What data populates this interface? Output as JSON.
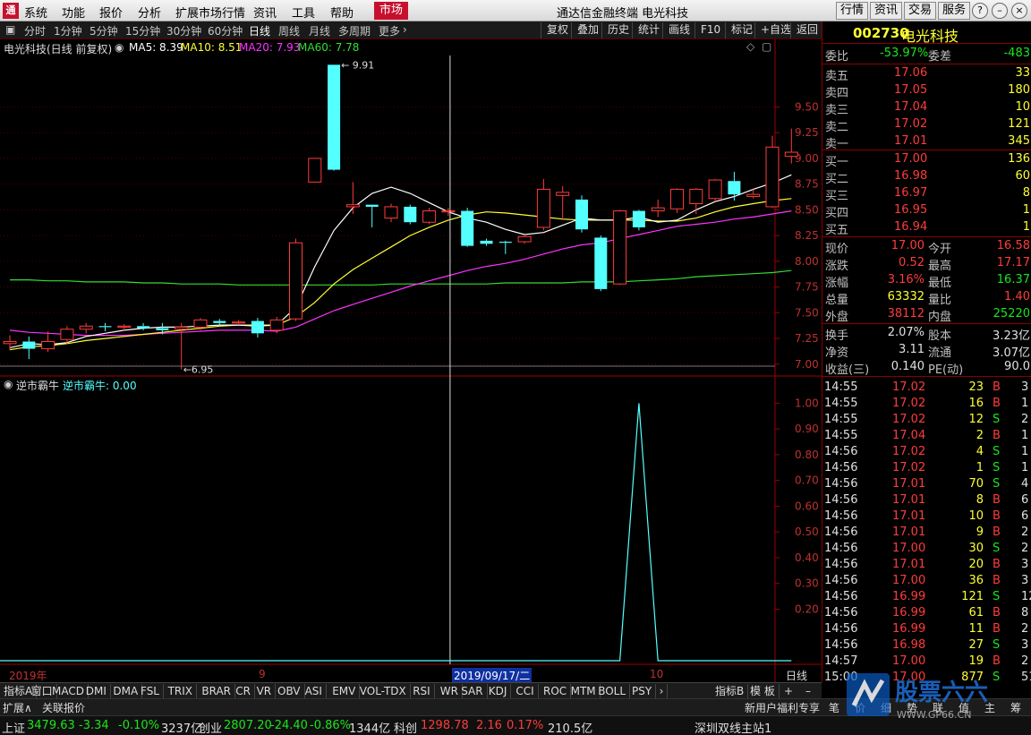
{
  "titlebar": {
    "logo": "通",
    "menu": [
      "系统",
      "功能",
      "报价",
      "分析",
      "扩展市场行情",
      "资讯",
      "工具",
      "帮助"
    ],
    "market_tab": "市场",
    "app_title": "通达信金融终端  电光科技",
    "buttons": [
      "行情",
      "资讯",
      "交易",
      "服务"
    ],
    "window_buttons": [
      "?",
      "–",
      "□",
      "×"
    ]
  },
  "periods": {
    "items": [
      "分时",
      "1分钟",
      "5分钟",
      "15分钟",
      "30分钟",
      "60分钟",
      "日线",
      "周线",
      "月线",
      "多周期",
      "更多"
    ],
    "active": "日线",
    "tools": [
      "复权",
      "叠加",
      "历史",
      "统计",
      "画线",
      "F10",
      "标记",
      "+自选",
      "返回"
    ]
  },
  "main_chart": {
    "title": "电光科技(日线 前复权)",
    "ma_labels": [
      {
        "text": "MA5: 8.39",
        "color": "#ffffff"
      },
      {
        "text": "MA10: 8.51",
        "color": "#ffff33"
      },
      {
        "text": "MA20: 7.93",
        "color": "#ff33ff"
      },
      {
        "text": "MA60: 7.78",
        "color": "#33dd33"
      }
    ],
    "high_label": "9.91",
    "low_label": "6.95",
    "y_ticks": [
      "9.50",
      "9.25",
      "9.00",
      "8.75",
      "8.50",
      "8.25",
      "8.00",
      "7.75",
      "7.50",
      "7.25",
      "7.00"
    ]
  },
  "chart_data": [
    {
      "type": "candlestick",
      "title": "电光科技(日线 前复权)",
      "ylim": [
        6.92,
        10.0
      ],
      "candles": [
        {
          "o": 7.2,
          "h": 7.28,
          "l": 7.14,
          "c": 7.22
        },
        {
          "o": 7.22,
          "h": 7.27,
          "l": 7.05,
          "c": 7.15
        },
        {
          "o": 7.15,
          "h": 7.32,
          "l": 7.12,
          "c": 7.22
        },
        {
          "o": 7.24,
          "h": 7.37,
          "l": 7.2,
          "c": 7.34
        },
        {
          "o": 7.34,
          "h": 7.4,
          "l": 7.3,
          "c": 7.37
        },
        {
          "o": 7.37,
          "h": 7.4,
          "l": 7.32,
          "c": 7.36
        },
        {
          "o": 7.36,
          "h": 7.39,
          "l": 7.32,
          "c": 7.37
        },
        {
          "o": 7.37,
          "h": 7.4,
          "l": 7.33,
          "c": 7.35
        },
        {
          "o": 7.35,
          "h": 7.4,
          "l": 7.29,
          "c": 7.33
        },
        {
          "o": 7.34,
          "h": 7.4,
          "l": 6.95,
          "c": 7.36
        },
        {
          "o": 7.36,
          "h": 7.45,
          "l": 7.33,
          "c": 7.43
        },
        {
          "o": 7.42,
          "h": 7.44,
          "l": 7.38,
          "c": 7.4
        },
        {
          "o": 7.4,
          "h": 7.43,
          "l": 7.38,
          "c": 7.41
        },
        {
          "o": 7.42,
          "h": 7.45,
          "l": 7.26,
          "c": 7.3
        },
        {
          "o": 7.33,
          "h": 7.46,
          "l": 7.3,
          "c": 7.43
        },
        {
          "o": 7.44,
          "h": 8.22,
          "l": 7.42,
          "c": 8.18
        },
        {
          "o": 8.77,
          "h": 9.0,
          "l": 8.77,
          "c": 9.0
        },
        {
          "o": 9.91,
          "h": 9.91,
          "l": 8.88,
          "c": 8.89
        },
        {
          "o": 8.53,
          "h": 8.77,
          "l": 8.46,
          "c": 8.55
        },
        {
          "o": 8.55,
          "h": 8.55,
          "l": 8.33,
          "c": 8.53
        },
        {
          "o": 8.42,
          "h": 8.56,
          "l": 8.38,
          "c": 8.53
        },
        {
          "o": 8.53,
          "h": 8.55,
          "l": 8.36,
          "c": 8.38
        },
        {
          "o": 8.38,
          "h": 8.52,
          "l": 8.36,
          "c": 8.49
        },
        {
          "o": 8.48,
          "h": 8.52,
          "l": 8.44,
          "c": 8.49
        },
        {
          "o": 8.49,
          "h": 8.52,
          "l": 8.14,
          "c": 8.15
        },
        {
          "o": 8.2,
          "h": 8.22,
          "l": 8.15,
          "c": 8.17
        },
        {
          "o": 8.19,
          "h": 8.2,
          "l": 8.07,
          "c": 8.18
        },
        {
          "o": 8.19,
          "h": 8.26,
          "l": 8.17,
          "c": 8.24
        },
        {
          "o": 8.33,
          "h": 8.8,
          "l": 8.3,
          "c": 8.7
        },
        {
          "o": 8.64,
          "h": 8.73,
          "l": 8.4,
          "c": 8.67
        },
        {
          "o": 8.6,
          "h": 8.64,
          "l": 8.28,
          "c": 8.31
        },
        {
          "o": 8.23,
          "h": 8.25,
          "l": 7.71,
          "c": 7.73
        },
        {
          "o": 7.78,
          "h": 8.5,
          "l": 7.77,
          "c": 8.49
        },
        {
          "o": 8.49,
          "h": 8.5,
          "l": 8.3,
          "c": 8.33
        },
        {
          "o": 8.49,
          "h": 8.6,
          "l": 8.43,
          "c": 8.52
        },
        {
          "o": 8.51,
          "h": 8.71,
          "l": 8.47,
          "c": 8.7
        },
        {
          "o": 8.56,
          "h": 8.71,
          "l": 8.46,
          "c": 8.7
        },
        {
          "o": 8.61,
          "h": 8.8,
          "l": 8.58,
          "c": 8.79
        },
        {
          "o": 8.78,
          "h": 8.87,
          "l": 8.59,
          "c": 8.65
        },
        {
          "o": 8.63,
          "h": 8.7,
          "l": 8.61,
          "c": 8.65
        },
        {
          "o": 8.53,
          "h": 9.22,
          "l": 8.52,
          "c": 9.11
        },
        {
          "o": 9.02,
          "h": 9.29,
          "l": 8.95,
          "c": 9.06
        }
      ],
      "ma5": [
        7.16,
        7.2,
        7.19,
        7.21,
        7.27,
        7.3,
        7.33,
        7.35,
        7.36,
        7.36,
        7.37,
        7.38,
        7.38,
        7.37,
        7.38,
        7.55,
        7.95,
        8.3,
        8.52,
        8.66,
        8.72,
        8.66,
        8.57,
        8.48,
        8.42,
        8.38,
        8.31,
        8.26,
        8.28,
        8.35,
        8.42,
        8.4,
        8.4,
        8.43,
        8.38,
        8.4,
        8.5,
        8.58,
        8.63,
        8.7,
        8.76,
        8.84
      ],
      "ma10": [
        7.14,
        7.17,
        7.18,
        7.2,
        7.23,
        7.25,
        7.27,
        7.29,
        7.31,
        7.33,
        7.35,
        7.37,
        7.38,
        7.38,
        7.38,
        7.46,
        7.6,
        7.78,
        7.92,
        8.03,
        8.14,
        8.25,
        8.33,
        8.4,
        8.45,
        8.48,
        8.47,
        8.45,
        8.43,
        8.41,
        8.4,
        8.4,
        8.4,
        8.4,
        8.39,
        8.39,
        8.42,
        8.48,
        8.53,
        8.56,
        8.59,
        8.61
      ],
      "ma20": [
        7.33,
        7.31,
        7.3,
        7.29,
        7.28,
        7.28,
        7.28,
        7.29,
        7.3,
        7.31,
        7.32,
        7.33,
        7.33,
        7.33,
        7.32,
        7.36,
        7.44,
        7.52,
        7.58,
        7.64,
        7.7,
        7.76,
        7.81,
        7.86,
        7.91,
        7.95,
        7.98,
        8.02,
        8.07,
        8.12,
        8.16,
        8.18,
        8.22,
        8.26,
        8.3,
        8.34,
        8.36,
        8.38,
        8.41,
        8.43,
        8.46,
        8.49
      ],
      "ma60": [
        7.82,
        7.82,
        7.81,
        7.81,
        7.8,
        7.8,
        7.8,
        7.79,
        7.79,
        7.78,
        7.78,
        7.78,
        7.77,
        7.77,
        7.77,
        7.77,
        7.77,
        7.77,
        7.77,
        7.77,
        7.78,
        7.78,
        7.78,
        7.78,
        7.78,
        7.78,
        7.79,
        7.79,
        7.79,
        7.79,
        7.8,
        7.8,
        7.8,
        7.81,
        7.82,
        7.83,
        7.85,
        7.86,
        7.87,
        7.88,
        7.89,
        7.91
      ]
    },
    {
      "type": "line",
      "name": "逆市霸牛",
      "ylim": [
        0,
        1.05
      ],
      "y_ticks": [
        1.0,
        0.9,
        0.8,
        0.7,
        0.6,
        0.5,
        0.4,
        0.3,
        0.2
      ],
      "values": [
        0,
        0,
        0,
        0,
        0,
        0,
        0,
        0,
        0,
        0,
        0,
        0,
        0,
        0,
        0,
        0,
        0,
        0,
        0,
        0,
        0,
        0,
        0,
        0,
        0,
        0,
        0,
        0,
        0,
        0,
        0,
        0,
        0,
        1,
        0,
        0,
        0,
        0,
        0,
        0,
        0,
        0
      ]
    }
  ],
  "indicator_chart": {
    "title": "逆市霸牛",
    "value_label": "逆市霸牛: 0.00"
  },
  "date_axis": {
    "labels": [
      "2019年",
      "9",
      "2019/09/17/二",
      "10"
    ],
    "period_label": "日线"
  },
  "quote": {
    "code": "002730",
    "name": "电光科技",
    "weibi_label": "委比",
    "weibi": "-53.97%",
    "weicha_label": "委差",
    "weicha": "-483",
    "asks": [
      {
        "label": "卖五",
        "price": "17.06",
        "vol": "33"
      },
      {
        "label": "卖四",
        "price": "17.05",
        "vol": "180"
      },
      {
        "label": "卖三",
        "price": "17.04",
        "vol": "10"
      },
      {
        "label": "卖二",
        "price": "17.02",
        "vol": "121"
      },
      {
        "label": "卖一",
        "price": "17.01",
        "vol": "345"
      }
    ],
    "bids": [
      {
        "label": "买一",
        "price": "17.00",
        "vol": "136"
      },
      {
        "label": "买二",
        "price": "16.98",
        "vol": "60"
      },
      {
        "label": "买三",
        "price": "16.97",
        "vol": "8"
      },
      {
        "label": "买四",
        "price": "16.95",
        "vol": "1"
      },
      {
        "label": "买五",
        "price": "16.94",
        "vol": "1"
      }
    ],
    "stats": [
      {
        "l1": "现价",
        "v1": "17.00",
        "c1": "red",
        "l2": "今开",
        "v2": "16.58",
        "c2": "red"
      },
      {
        "l1": "涨跌",
        "v1": "0.52",
        "c1": "red",
        "l2": "最高",
        "v2": "17.17",
        "c2": "red"
      },
      {
        "l1": "涨幅",
        "v1": "3.16%",
        "c1": "red",
        "l2": "最低",
        "v2": "16.37",
        "c2": "green"
      },
      {
        "l1": "总量",
        "v1": "63332",
        "c1": "yellow",
        "l2": "量比",
        "v2": "1.40",
        "c2": "red"
      },
      {
        "l1": "外盘",
        "v1": "38112",
        "c1": "red",
        "l2": "内盘",
        "v2": "25220",
        "c2": "green"
      }
    ],
    "stats2": [
      {
        "l1": "换手",
        "v1": "2.07%",
        "l2": "股本",
        "v2": "3.23亿"
      },
      {
        "l1": "净资",
        "v1": "3.11",
        "l2": "流通",
        "v2": "3.07亿"
      },
      {
        "l1": "收益(三)",
        "v1": "0.140",
        "l2": "PE(动)",
        "v2": "90.0"
      }
    ]
  },
  "ticks": [
    {
      "t": "14:55",
      "p": "17.02",
      "v": "23",
      "d": "B",
      "n": "3"
    },
    {
      "t": "14:55",
      "p": "17.02",
      "v": "16",
      "d": "B",
      "n": "1"
    },
    {
      "t": "14:55",
      "p": "17.02",
      "v": "12",
      "d": "S",
      "n": "2"
    },
    {
      "t": "14:55",
      "p": "17.04",
      "v": "2",
      "d": "B",
      "n": "1"
    },
    {
      "t": "14:56",
      "p": "17.02",
      "v": "4",
      "d": "S",
      "n": "1"
    },
    {
      "t": "14:56",
      "p": "17.02",
      "v": "1",
      "d": "S",
      "n": "1"
    },
    {
      "t": "14:56",
      "p": "17.01",
      "v": "70",
      "d": "S",
      "n": "4"
    },
    {
      "t": "14:56",
      "p": "17.01",
      "v": "8",
      "d": "B",
      "n": "6"
    },
    {
      "t": "14:56",
      "p": "17.01",
      "v": "10",
      "d": "B",
      "n": "6"
    },
    {
      "t": "14:56",
      "p": "17.01",
      "v": "9",
      "d": "B",
      "n": "2"
    },
    {
      "t": "14:56",
      "p": "17.00",
      "v": "30",
      "d": "S",
      "n": "2"
    },
    {
      "t": "14:56",
      "p": "17.01",
      "v": "20",
      "d": "B",
      "n": "3"
    },
    {
      "t": "14:56",
      "p": "17.00",
      "v": "36",
      "d": "B",
      "n": "3"
    },
    {
      "t": "14:56",
      "p": "16.99",
      "v": "121",
      "d": "S",
      "n": "12"
    },
    {
      "t": "14:56",
      "p": "16.99",
      "v": "61",
      "d": "B",
      "n": "8"
    },
    {
      "t": "14:56",
      "p": "16.99",
      "v": "11",
      "d": "B",
      "n": "2"
    },
    {
      "t": "14:56",
      "p": "16.98",
      "v": "27",
      "d": "S",
      "n": "3"
    },
    {
      "t": "14:57",
      "p": "17.00",
      "v": "19",
      "d": "B",
      "n": "2"
    },
    {
      "t": "15:00",
      "p": "17.00",
      "v": "877",
      "d": "S",
      "n": "51"
    }
  ],
  "indicator_tabs": [
    "指标A",
    "窗口",
    "MACD",
    "DMI",
    "DMA",
    "FSL",
    "TRIX",
    "BRAR",
    "CR",
    "VR",
    "OBV",
    "ASI",
    "EMV",
    "VOL-TDX",
    "RSI",
    "WR",
    "SAR",
    "KDJ",
    "CCI",
    "ROC",
    "MTM",
    "BOLL",
    "PSY"
  ],
  "indicator_right": [
    "指标B",
    "模 板",
    "+",
    "–"
  ],
  "row2": {
    "left": [
      "扩展∧",
      "关联报价"
    ],
    "right": [
      "新用户福利专享",
      "笔",
      "价",
      "细",
      "势",
      "联",
      "值",
      "主",
      "筹"
    ]
  },
  "status": [
    {
      "t": "上证",
      "c": "white"
    },
    {
      "t": "3479.63",
      "c": "green"
    },
    {
      "t": "-3.34",
      "c": "green"
    },
    {
      "t": "-0.10%",
      "c": "green"
    },
    {
      "t": "3237亿",
      "c": "white"
    },
    {
      "t": "创业",
      "c": "white"
    },
    {
      "t": "2807.20",
      "c": "green"
    },
    {
      "t": "-24.40",
      "c": "green"
    },
    {
      "t": "-0.86%",
      "c": "green"
    },
    {
      "t": "1344亿",
      "c": "white"
    },
    {
      "t": "科创",
      "c": "white"
    },
    {
      "t": "1298.78",
      "c": "red"
    },
    {
      "t": "2.16",
      "c": "red"
    },
    {
      "t": "0.17%",
      "c": "red"
    },
    {
      "t": "210.5亿",
      "c": "white"
    },
    {
      "t": "深圳双线主站1",
      "c": "white"
    }
  ],
  "watermark": {
    "text": "股票六六",
    "url": "WWW.GP66.CN"
  },
  "colors": {
    "up": "#ff3b3b",
    "down": "#54ffff",
    "grid": "#5a0000",
    "axis": "#a00000"
  }
}
